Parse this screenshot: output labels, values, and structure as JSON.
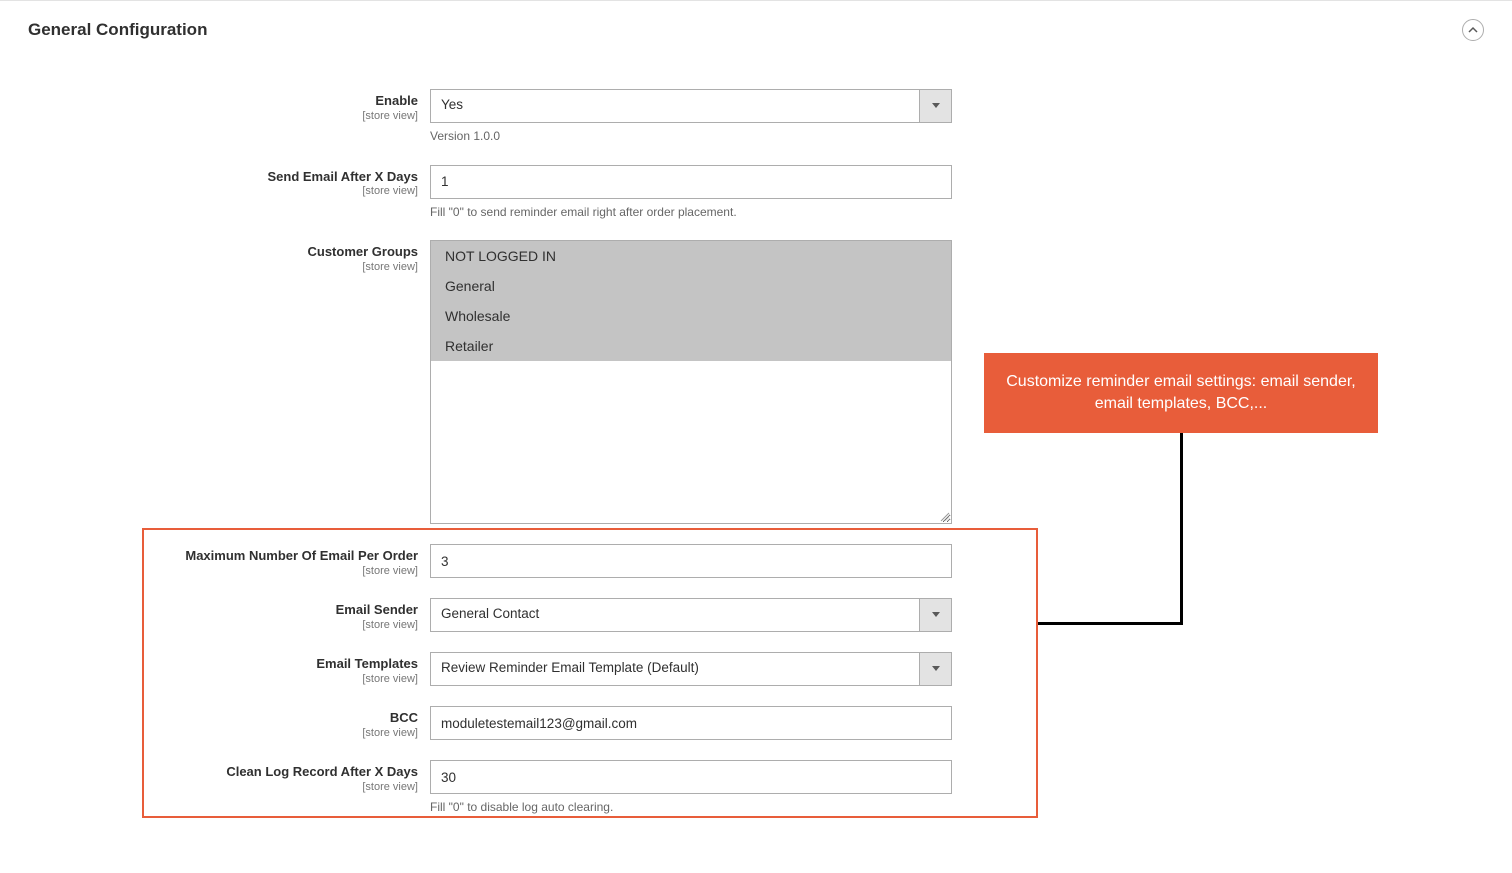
{
  "section": {
    "title": "General Configuration"
  },
  "scope_label": "[store view]",
  "fields": {
    "enable": {
      "label": "Enable",
      "value": "Yes",
      "note": "Version 1.0.0"
    },
    "send_after": {
      "label": "Send Email After X Days",
      "value": "1",
      "note": "Fill \"0\" to send reminder email right after order placement."
    },
    "customer_groups": {
      "label": "Customer Groups",
      "options": [
        "NOT LOGGED IN",
        "General",
        "Wholesale",
        "Retailer"
      ]
    },
    "max_email": {
      "label": "Maximum Number Of Email Per Order",
      "value": "3"
    },
    "email_sender": {
      "label": "Email Sender",
      "value": "General Contact"
    },
    "email_templates": {
      "label": "Email Templates",
      "value": "Review Reminder Email Template (Default)"
    },
    "bcc": {
      "label": "BCC",
      "value": "moduletestemail123@gmail.com"
    },
    "clean_log": {
      "label": "Clean Log Record After X Days",
      "value": "30",
      "note": "Fill \"0\" to disable log auto clearing."
    }
  },
  "callout": {
    "text": "Customize reminder email settings: email sender, email templates, BCC,..."
  }
}
